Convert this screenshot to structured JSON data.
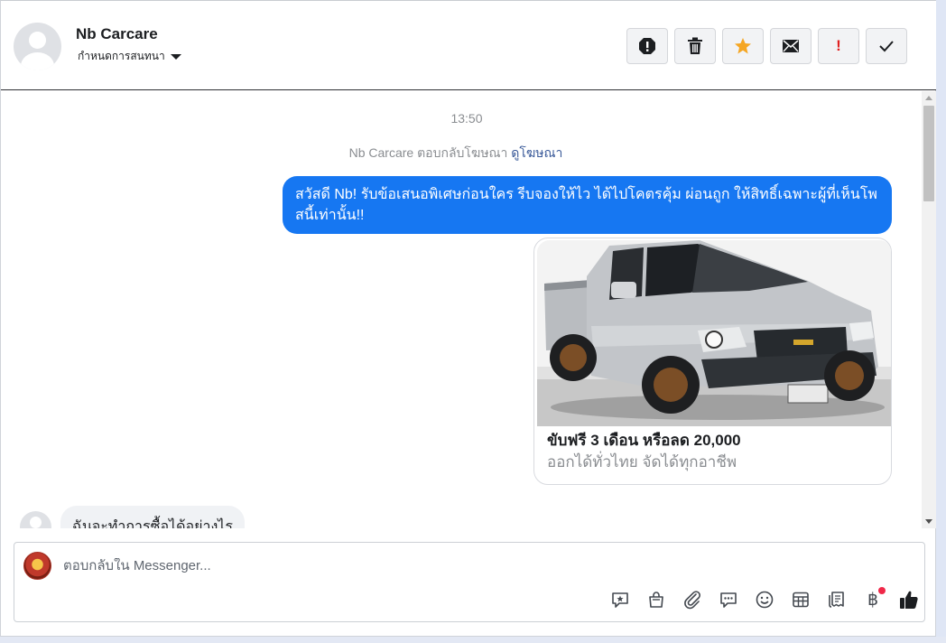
{
  "header": {
    "name": "Nb Carcare",
    "assign_label": "กำหนดการสนทนา"
  },
  "toolbar": {
    "buttons": [
      "spam-report",
      "delete",
      "star",
      "mark-unread",
      "important",
      "done"
    ],
    "important_glyph": "!"
  },
  "chat": {
    "time": "13:50",
    "reply_note": "Nb Carcare ตอบกลับโฆษณา",
    "reply_link": "ดูโฆษณา",
    "outgoing_message": "สวัสดี Nb! รับข้อเสนอพิเศษก่อนใคร รีบจองให้ไว ได้ไปโคตรคุ้ม ผ่อนถูก ให้สิทธิ์เฉพาะผู้ที่เห็นโพสนี้เท่านั้น!!",
    "card": {
      "title": "ขับฟรี 3 เดือน หรือลด 20,000",
      "subtitle": "ออกได้ทั่วไทย จัดได้ทุกอาชีพ",
      "image_alt": "silver Chevrolet pickup truck"
    },
    "incoming_message": "ฉันจะทำการซื้อได้อย่างไร"
  },
  "composer": {
    "placeholder": "ตอบกลับใน Messenger...",
    "tools": [
      "saved-replies",
      "shop",
      "attachment",
      "message",
      "emoji",
      "appointment",
      "orders",
      "payment",
      "like"
    ],
    "payment_glyph": "฿"
  },
  "colors": {
    "bubble_out": "#1677f2",
    "star": "#f5a623",
    "important": "#e02020",
    "notification_dot": "#f02849"
  }
}
